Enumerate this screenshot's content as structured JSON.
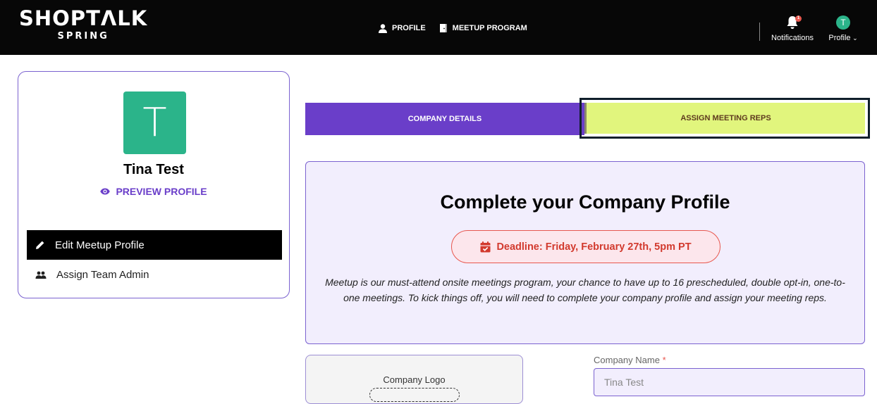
{
  "header": {
    "logo_main": "SHOPTΛLK",
    "logo_sub": "SPRING",
    "nav": [
      {
        "label": "PROFILE",
        "icon": "person-icon"
      },
      {
        "label": "MEETUP PROGRAM",
        "icon": "door-icon"
      }
    ],
    "notifications_label": "Notifications",
    "notifications_count": "1",
    "profile_label": "Profile",
    "profile_initial": "T"
  },
  "sidebar": {
    "avatar_initial": "T",
    "user_name": "Tina Test",
    "preview_label": "PREVIEW PROFILE",
    "menu": [
      {
        "label": "Edit Meetup Profile",
        "icon": "pencil-icon",
        "active": true
      },
      {
        "label": "Assign Team Admin",
        "icon": "group-icon",
        "active": false
      }
    ]
  },
  "tabs": [
    {
      "label": "COMPANY DETAILS",
      "active": true
    },
    {
      "label": "ASSIGN MEETING REPS",
      "active": false
    }
  ],
  "info": {
    "title": "Complete your Company Profile",
    "deadline": "Deadline: Friday, February 27th, 5pm PT",
    "text": "Meetup is our must-attend onsite meetings program, your chance to have up to 16 prescheduled, double opt-in, one-to-one meetings. To kick things off, you will need to complete your company profile and assign your meeting reps."
  },
  "form": {
    "logo_label": "Company Logo",
    "company_name_label": "Company Name",
    "company_name_required": "*",
    "company_name_value": "Tina Test"
  },
  "colors": {
    "header_bg": "#070707",
    "accent_purple": "#6a3ec9",
    "accent_green": "#2bb48a",
    "tab_yellow": "#e1f57d",
    "deadline_red": "#d23a2e",
    "panel_bg": "#f2eefd"
  }
}
